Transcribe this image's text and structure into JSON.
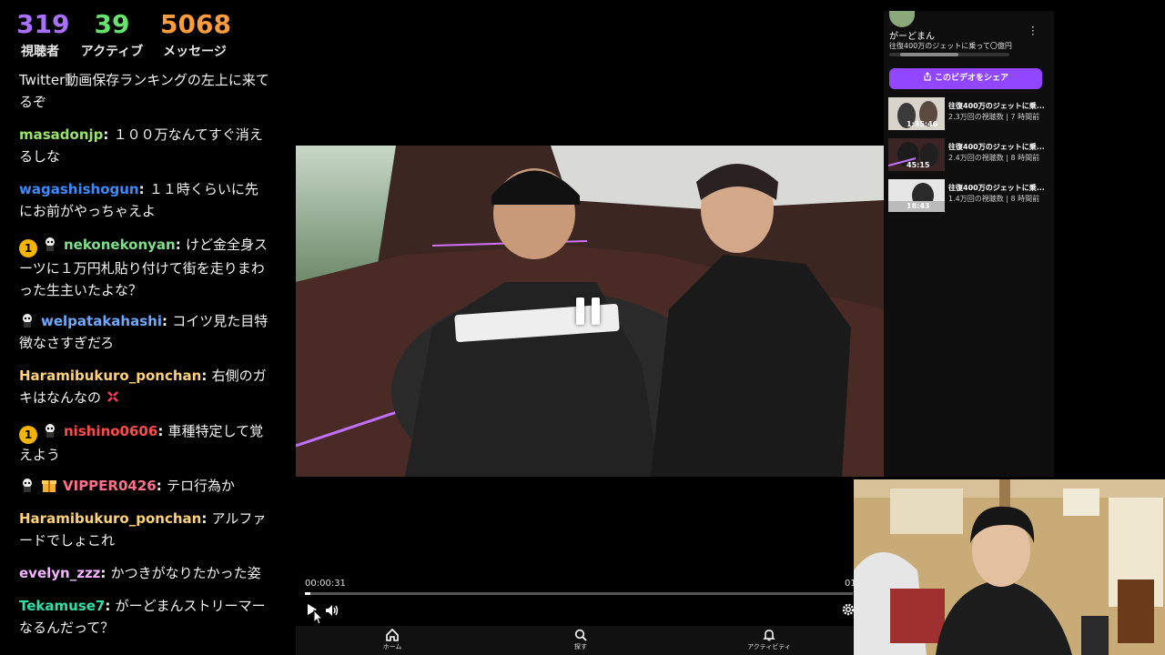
{
  "stats": {
    "viewers": "319",
    "viewers_label": "視聴者",
    "active": "39",
    "active_label": "アクティブ",
    "messages": "5068",
    "messages_label": "メッセージ"
  },
  "chat": [
    {
      "user": "",
      "color": "#ffffff",
      "text": "Twitter動画保存ランキングの左上に来てるぞ"
    },
    {
      "user": "masadonjp",
      "color": "#9be36a",
      "text": "１００万なんてすぐ消えるしな"
    },
    {
      "user": "wagashishogun",
      "color": "#3a8bff",
      "text": "１１時くらいに先にお前がやっちゃえよ"
    },
    {
      "user": "nekonekonyan",
      "color": "#7ee08a",
      "badge": "1",
      "text": "けど金全身スーツに１万円札貼り付けて街を走りまわった生主いたよな？"
    },
    {
      "user": "welpatakahashi",
      "color": "#6fa8ff",
      "text": "コイツ見た目特徴なさすぎだろ"
    },
    {
      "user": "Haramibukuro_ponchan",
      "color": "#ffd27a",
      "text": "右側のガキはなんなの"
    },
    {
      "user": "nishino0606",
      "color": "#ff4a4a",
      "badge": "1",
      "text": "車種特定して覚えよう"
    },
    {
      "user": "VIPPER0426",
      "color": "#ff6f8a",
      "text": "テロ行為か"
    },
    {
      "user": "Haramibukuro_ponchan",
      "color": "#ffd27a",
      "text": "アルファードでしょこれ"
    },
    {
      "user": "evelyn_zzz",
      "color": "#f4b3ff",
      "text": "かつきがなりたかった姿"
    },
    {
      "user": "Tekamuse7",
      "color": "#2fe0a8",
      "text": "がーどまんストリーマーなるんだって？"
    }
  ],
  "player": {
    "current_time": "00:00:31",
    "end_time": "01",
    "progress": 0.01
  },
  "nav": {
    "home": "ホーム",
    "search": "探す",
    "activity": "アクティビティ"
  },
  "side": {
    "channel": "がーどまん",
    "title": "往復400万のジェットに乗って〇億円",
    "share": "このビデオをシェア",
    "recs": [
      {
        "title": "往復400万のジェットに乗...",
        "meta": "2.3万回の視聴数 | 7 時間前",
        "duration": "1:35:46"
      },
      {
        "title": "往復400万のジェットに乗...",
        "meta": "2.4万回の視聴数 | 8 時間前",
        "duration": "45:15"
      },
      {
        "title": "往復400万のジェットに乗...",
        "meta": "1.4万回の視聴数 | 8 時間前",
        "duration": "18:43"
      }
    ]
  }
}
